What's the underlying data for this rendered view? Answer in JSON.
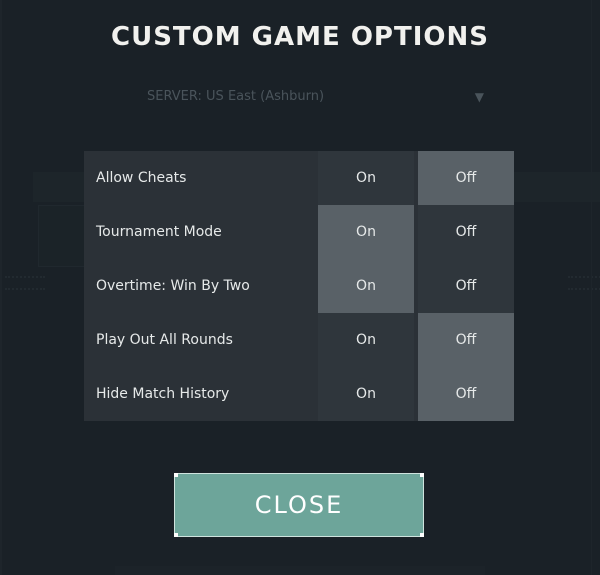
{
  "dialog": {
    "title": "CUSTOM GAME OPTIONS",
    "close_label": "CLOSE"
  },
  "background": {
    "dropdown_value": "SERVER: US East (Ashburn)",
    "dropdown_caret_icon": "chevron-down-icon"
  },
  "options": [
    {
      "label": "Allow Cheats",
      "on_label": "On",
      "off_label": "Off",
      "selected": "off"
    },
    {
      "label": "Tournament Mode",
      "on_label": "On",
      "off_label": "Off",
      "selected": "on"
    },
    {
      "label": "Overtime: Win By Two",
      "on_label": "On",
      "off_label": "Off",
      "selected": "on"
    },
    {
      "label": "Play Out All Rounds",
      "on_label": "On",
      "off_label": "Off",
      "selected": "off"
    },
    {
      "label": "Hide Match History",
      "on_label": "On",
      "off_label": "Off",
      "selected": "off"
    }
  ],
  "colors": {
    "selected_toggle": "#596167",
    "unselected_toggle": "#2f363c",
    "close_button": "#6da59a"
  }
}
